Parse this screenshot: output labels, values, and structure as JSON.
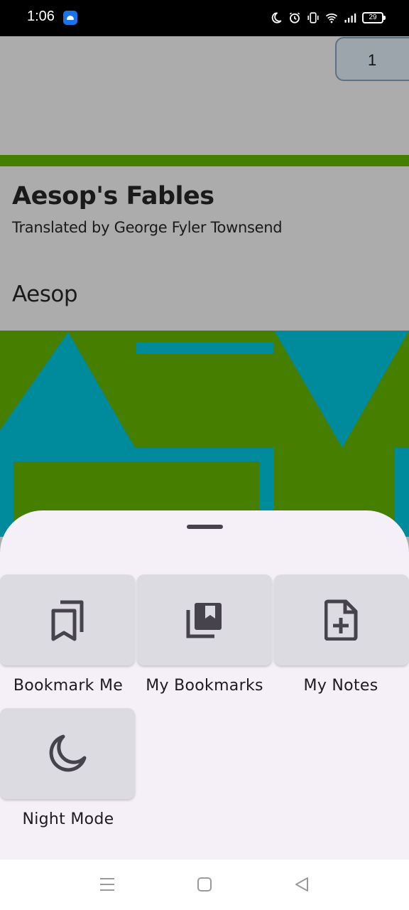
{
  "status_bar": {
    "time": "1:06",
    "battery": "29",
    "icons": [
      "android-app-icon",
      "moon-icon",
      "alarm-icon",
      "vibrate-icon",
      "wifi-icon",
      "signal-icon",
      "battery-icon"
    ]
  },
  "reader": {
    "page_number": "1",
    "book_title": "Aesop's Fables",
    "book_subtitle": "Translated by George Fyler Townsend",
    "book_author": "Aesop",
    "colors": {
      "cover_green": "#467e00",
      "cover_teal": "#008b9d",
      "cover_gray": "#acacac"
    }
  },
  "sheet": {
    "actions": [
      {
        "label": "Bookmark Me",
        "icon": "bookmark-icon"
      },
      {
        "label": "My Bookmarks",
        "icon": "bookmarks-library-icon"
      },
      {
        "label": "My Notes",
        "icon": "note-add-icon"
      },
      {
        "label": "Night Mode",
        "icon": "moon-icon"
      }
    ]
  },
  "nav_bar": {
    "buttons": [
      "menu-icon",
      "home-icon",
      "back-icon"
    ]
  }
}
